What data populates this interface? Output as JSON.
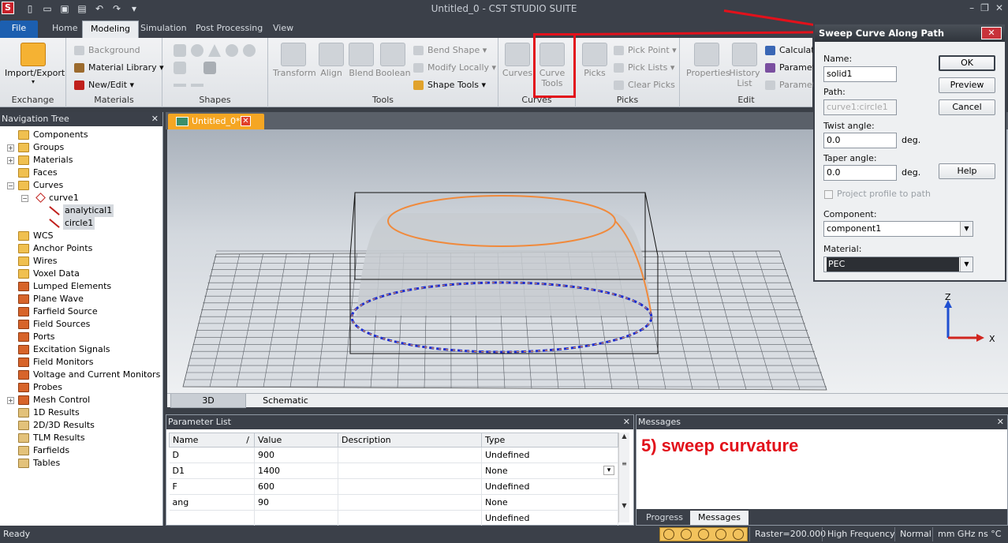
{
  "titlebar": {
    "title": "Untitled_0 - CST STUDIO SUITE",
    "app_icon": "S"
  },
  "ribbon_tabs": [
    "File",
    "Home",
    "Modeling",
    "Simulation",
    "Post Processing",
    "View"
  ],
  "ribbon": {
    "import_export": "Import/Export",
    "groups": {
      "exchange": "Exchange",
      "materials": "Materials",
      "shapes": "Shapes",
      "tools": "Tools",
      "curves": "Curves",
      "picks": "Picks",
      "edit": "Edit"
    },
    "background": "Background",
    "material_library": "Material Library",
    "new_edit": "New/Edit",
    "transform": "Transform",
    "align": "Align",
    "blend": "Blend",
    "boolean": "Boolean",
    "bend_shape": "Bend Shape",
    "modify_locally": "Modify Locally",
    "shape_tools": "Shape Tools",
    "curves_btn": "Curves",
    "curve_tools_line1": "Curve",
    "curve_tools_line2": "Tools",
    "picks_btn": "Picks",
    "pick_point": "Pick Point",
    "pick_lists": "Pick Lists",
    "clear_picks": "Clear Picks",
    "properties": "Properties",
    "history_list_line1": "History",
    "history_list_line2": "List",
    "calculator": "Calculato",
    "parameter": "Paramet",
    "parameter2": "Paramet"
  },
  "navtree": {
    "title": "Navigation Tree",
    "items": [
      "Components",
      "Groups",
      "Materials",
      "Faces",
      "Curves",
      "curve1",
      "analytical1",
      "circle1",
      "WCS",
      "Anchor Points",
      "Wires",
      "Voxel Data",
      "Lumped Elements",
      "Plane Wave",
      "Farfield Source",
      "Field Sources",
      "Ports",
      "Excitation Signals",
      "Field Monitors",
      "Voltage and Current Monitors",
      "Probes",
      "Mesh Control",
      "1D Results",
      "2D/3D Results",
      "TLM Results",
      "Farfields",
      "Tables"
    ]
  },
  "doc_tab": "Untitled_0*",
  "view_tabs": {
    "tab_3d": "3D",
    "tab_schematic": "Schematic"
  },
  "param_list": {
    "title": "Parameter List",
    "columns": [
      "Name",
      "Value",
      "Description",
      "Type"
    ],
    "rows": [
      {
        "name": "D",
        "value": "900",
        "description": "",
        "type": "Undefined"
      },
      {
        "name": "D1",
        "value": "1400",
        "description": "",
        "type": "None"
      },
      {
        "name": "F",
        "value": "600",
        "description": "",
        "type": "Undefined"
      },
      {
        "name": "ang",
        "value": "90",
        "description": "",
        "type": "None"
      },
      {
        "name": "",
        "value": "",
        "description": "",
        "type": "Undefined"
      }
    ]
  },
  "messages": {
    "title": "Messages",
    "text": "5) sweep curvature",
    "tab_progress": "Progress",
    "tab_messages": "Messages"
  },
  "statusbar": {
    "ready": "Ready",
    "raster": "Raster=200.000",
    "mode": "High Frequency",
    "view": "Normal",
    "units": "mm  GHz  ns  °C"
  },
  "dialog": {
    "title": "Sweep Curve Along Path",
    "name_label": "Name:",
    "name_value": "solid1",
    "path_label": "Path:",
    "path_value": "curve1:circle1",
    "twist_label": "Twist angle:",
    "twist_value": "0.0",
    "taper_label": "Taper angle:",
    "taper_value": "0.0",
    "deg": "deg.",
    "project_label": "Project profile to path",
    "component_label": "Component:",
    "component_value": "component1",
    "material_label": "Material:",
    "material_value": "PEC",
    "ok": "OK",
    "preview": "Preview",
    "cancel": "Cancel",
    "help": "Help"
  },
  "axes": {
    "z": "Z",
    "x": "X"
  },
  "colors": {
    "annotation_red": "#e2111b",
    "file_tab_blue": "#1c5fb0",
    "doc_tab_orange": "#f5a623",
    "dark_chrome": "#3b4049"
  }
}
